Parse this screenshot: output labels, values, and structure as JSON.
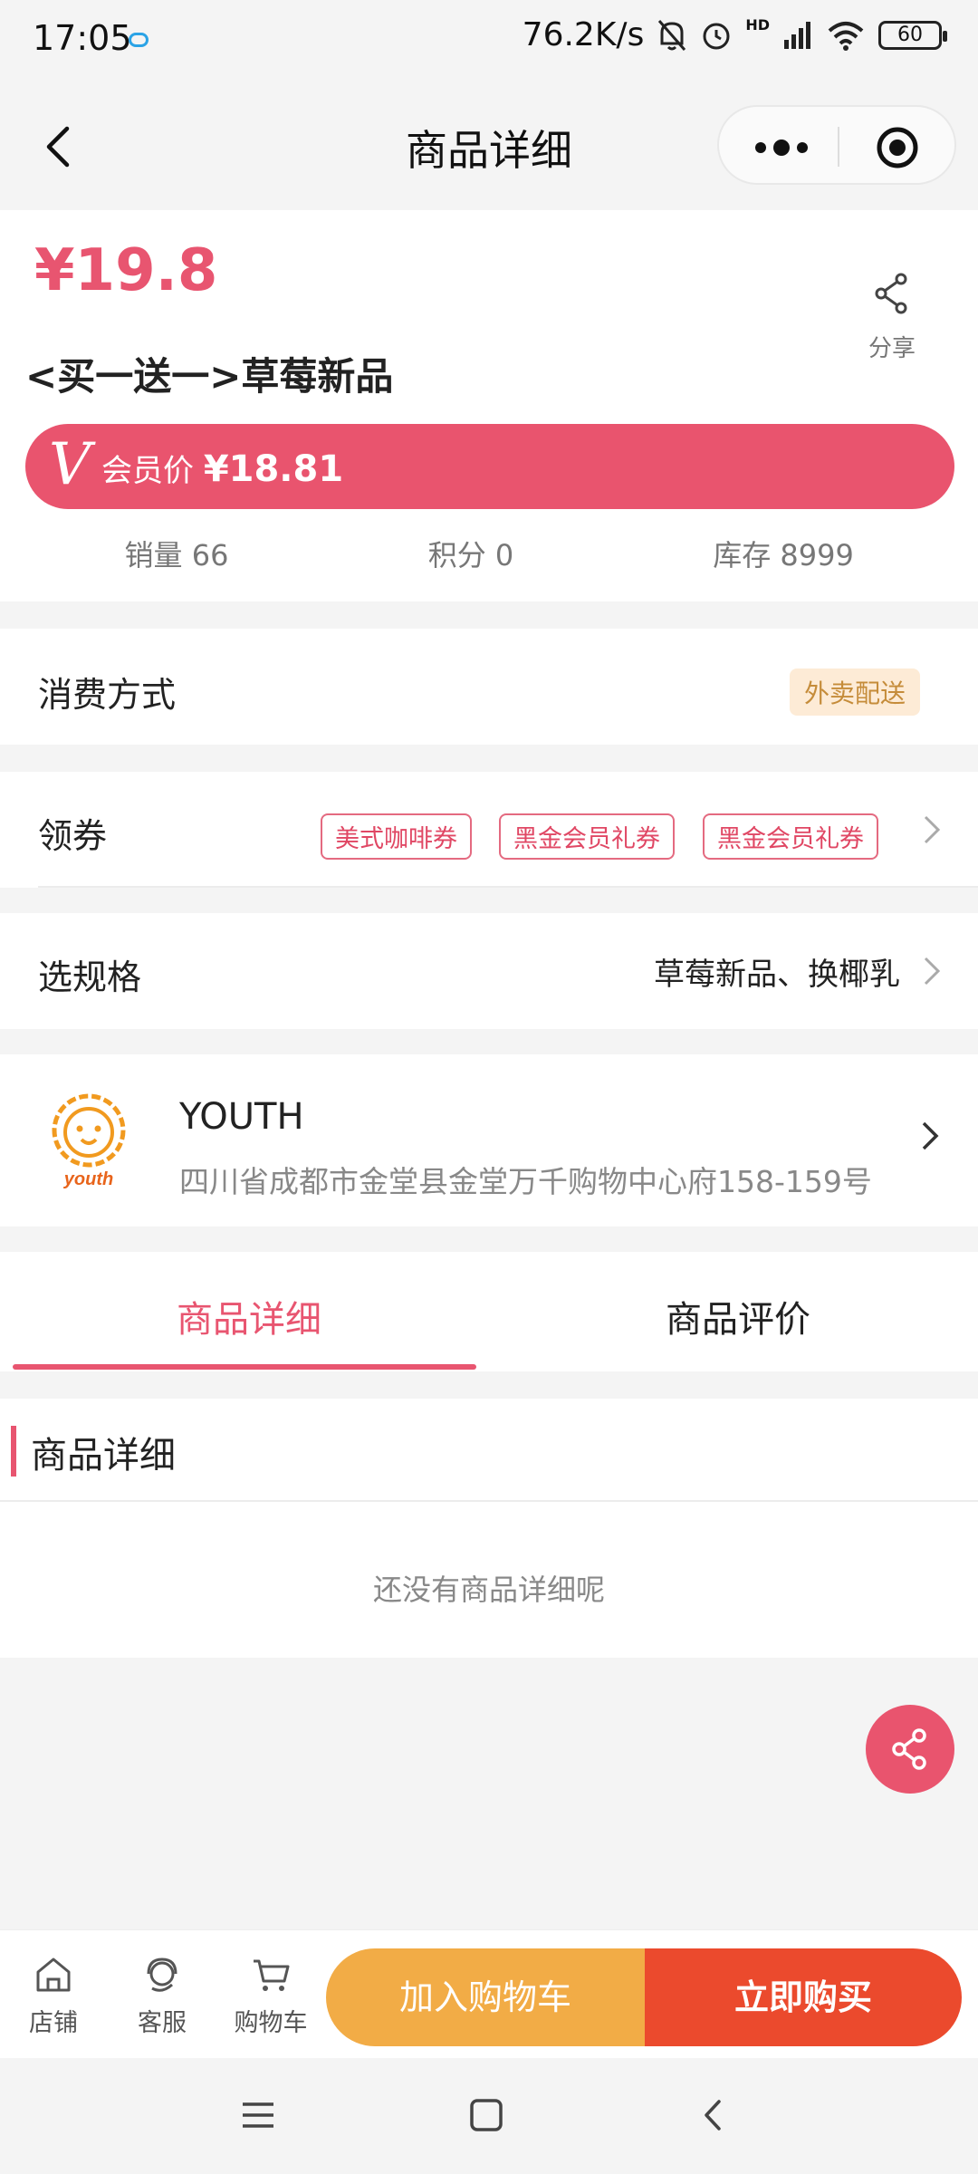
{
  "status_bar": {
    "time": "17:05",
    "network_speed": "76.2K/s",
    "network_type": "HD",
    "battery": "60"
  },
  "nav": {
    "title": "商品详细"
  },
  "product": {
    "price": "¥19.8",
    "title": "<买一送一>草莓新品",
    "share_label": "分享",
    "vip_badge": "V",
    "vip_label": "会员价",
    "vip_price": "¥18.81",
    "stats": {
      "sales": "销量 66",
      "points": "积分 0",
      "stock": "库存 8999"
    }
  },
  "consumption": {
    "label": "消费方式",
    "tag": "外卖配送"
  },
  "coupons": {
    "label": "领券",
    "items": [
      "美式咖啡券",
      "黑金会员礼券",
      "黑金会员礼券"
    ]
  },
  "spec": {
    "label": "选规格",
    "value": "草莓新品、换椰乳"
  },
  "store": {
    "logo_text": "youth",
    "name": "YOUTH",
    "address": "四川省成都市金堂县金堂万千购物中心府158-159号"
  },
  "tabs": {
    "items": [
      "商品详细",
      "商品评价"
    ],
    "active": 0
  },
  "details": {
    "heading": "商品详细",
    "empty_text": "还没有商品详细呢"
  },
  "bottom_bar": {
    "store": "店铺",
    "service": "客服",
    "cart": "购物车",
    "add_to_cart": "加入购物车",
    "buy_now": "立即购买"
  },
  "colors": {
    "accent": "#e85570",
    "cart_button": "#f2ac46",
    "buy_button": "#eb4a2d"
  }
}
